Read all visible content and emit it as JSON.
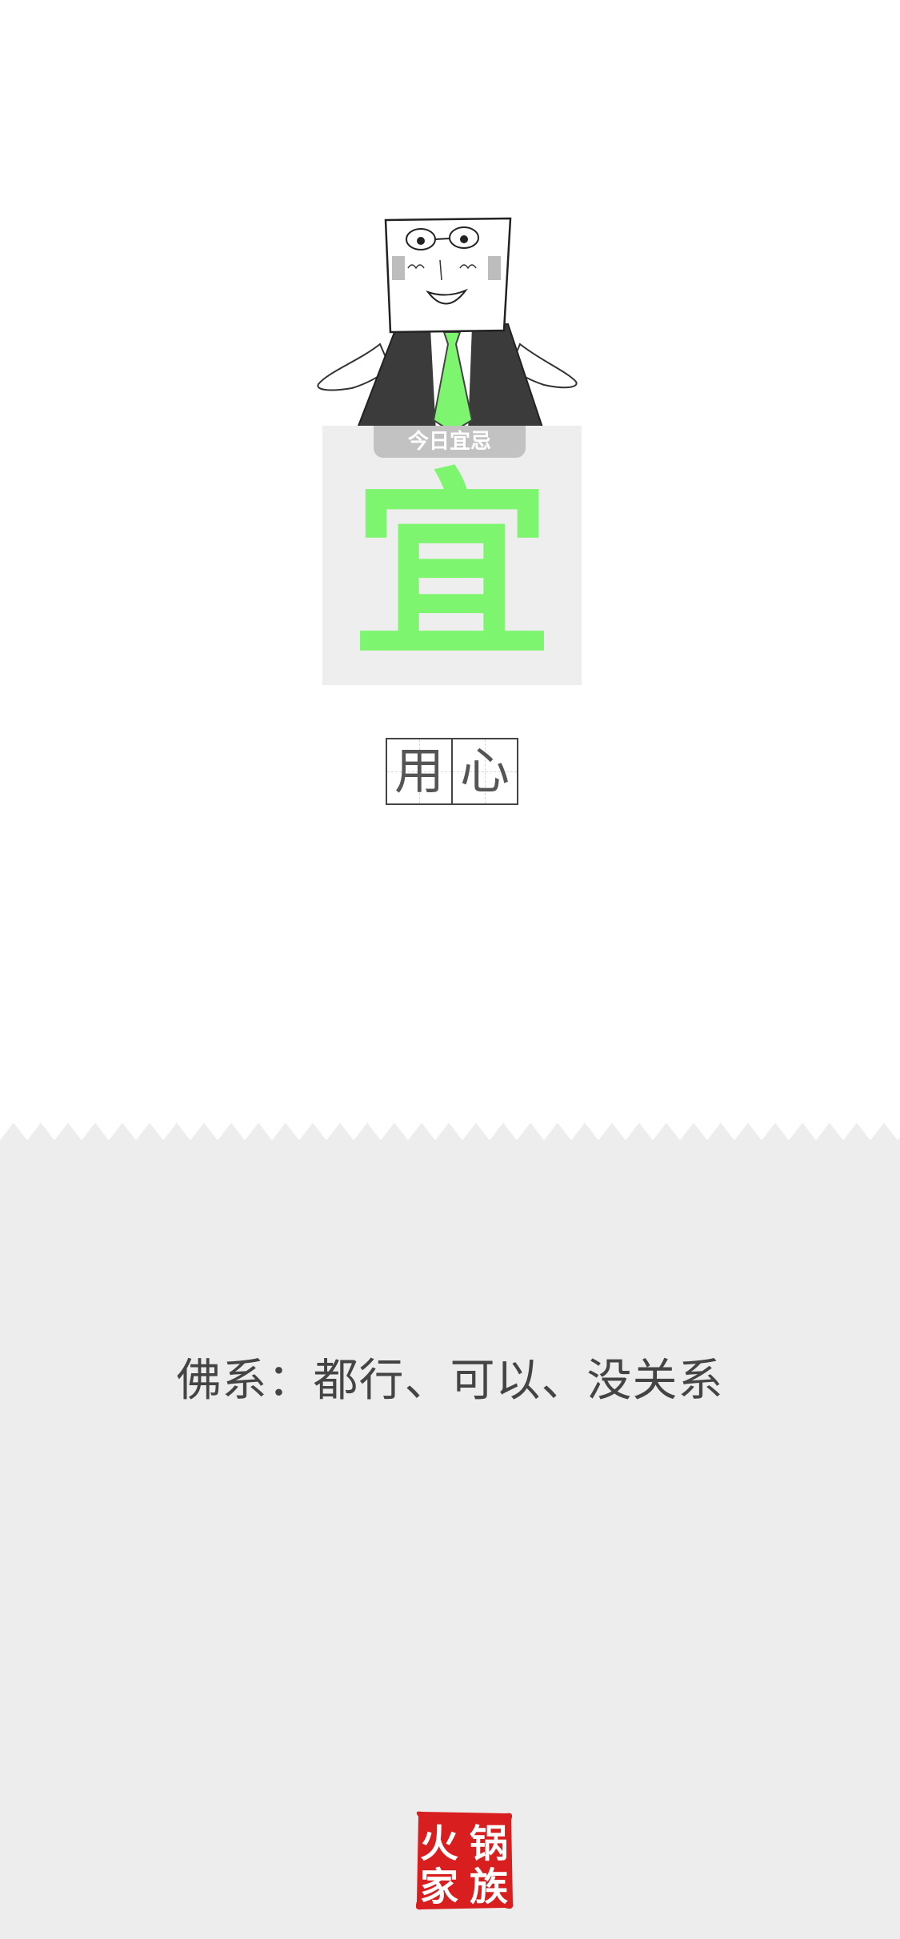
{
  "card": {
    "tab_label": "今日宜忌",
    "big_char": "宜",
    "big_char_color": "#7ef56f"
  },
  "words": [
    "用",
    "心"
  ],
  "quote": "佛系：都行、可以、没关系",
  "seal": {
    "text": "火锅家族",
    "color": "#d81e1e"
  },
  "icons": {
    "character": "box-head-man-illustration",
    "seal": "red-seal-stamp"
  }
}
